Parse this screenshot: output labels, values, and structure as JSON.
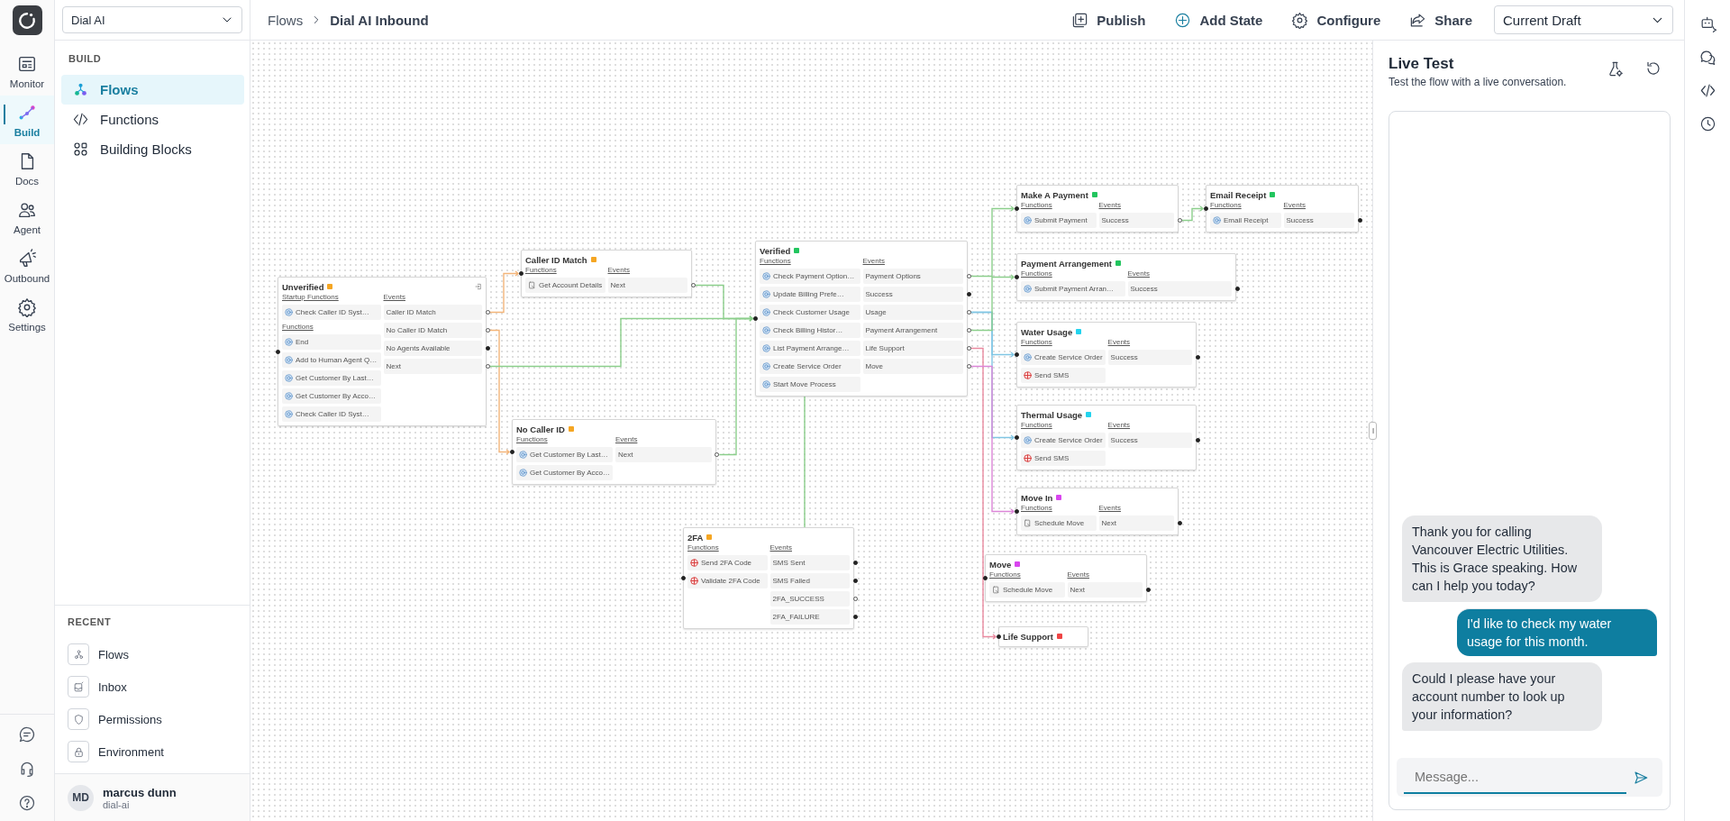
{
  "workspace": {
    "value": "Dial AI"
  },
  "rail": {
    "items": [
      {
        "label": "Monitor",
        "kind": "monitor",
        "selected": false
      },
      {
        "label": "Build",
        "kind": "build",
        "selected": true
      },
      {
        "label": "Docs",
        "kind": "docs",
        "selected": false
      },
      {
        "label": "Agent",
        "kind": "agent",
        "selected": false
      },
      {
        "label": "Outbound",
        "kind": "outbound",
        "selected": false
      },
      {
        "label": "Settings",
        "kind": "settings",
        "selected": false
      }
    ]
  },
  "sidebar": {
    "heading": "BUILD",
    "items": [
      {
        "label": "Flows",
        "kind": "flows",
        "selected": true
      },
      {
        "label": "Functions",
        "kind": "functions",
        "selected": false
      },
      {
        "label": "Building Blocks",
        "kind": "blocks",
        "selected": false
      }
    ]
  },
  "recent": {
    "heading": "RECENT",
    "items": [
      {
        "label": "Flows",
        "kind": "flows"
      },
      {
        "label": "Inbox",
        "kind": "inbox"
      },
      {
        "label": "Permissions",
        "kind": "permissions"
      },
      {
        "label": "Environment",
        "kind": "environment"
      }
    ]
  },
  "user": {
    "initials": "MD",
    "name": "marcus dunn",
    "org": "dial-ai"
  },
  "breadcrumb": [
    "Flows",
    "Dial AI Inbound"
  ],
  "actions": [
    {
      "label": "Publish",
      "kind": "publish"
    },
    {
      "label": "Add State",
      "kind": "add"
    },
    {
      "label": "Configure",
      "kind": "configure"
    },
    {
      "label": "Share",
      "kind": "share"
    }
  ],
  "version": {
    "value": "Current Draft"
  },
  "flow": {
    "nodes": [
      {
        "title": "Unverified",
        "color": "#f5a623",
        "start": true,
        "sections": [
          {
            "heading": "Startup Functions",
            "items": [
              {
                "label": "Check Caller ID Syst…",
                "kind": "system"
              }
            ]
          },
          {
            "heading": "Functions",
            "items": [
              {
                "label": "End",
                "kind": "system"
              },
              {
                "label": "Add to Human Agent Q…",
                "kind": "system"
              },
              {
                "label": "Get Customer By Last…",
                "kind": "system"
              },
              {
                "label": "Get Customer By Acco…",
                "kind": "system"
              },
              {
                "label": "Check Caller ID Syst…",
                "kind": "system"
              }
            ]
          }
        ],
        "events_heading": "Events",
        "events": [
          "Caller ID Match",
          "No Caller ID Match",
          "No Agents Available",
          "Next"
        ]
      },
      {
        "title": "Caller ID Match",
        "color": "#f5a623",
        "start": false,
        "sections": [
          {
            "heading": "Functions",
            "items": [
              {
                "label": "Get Account Details",
                "kind": "doc"
              }
            ]
          }
        ],
        "events_heading": "Events",
        "events": [
          "Next"
        ]
      },
      {
        "title": "No Caller ID",
        "color": "#f5a623",
        "start": false,
        "sections": [
          {
            "heading": "Functions",
            "items": [
              {
                "label": "Get Customer By Last…",
                "kind": "system"
              },
              {
                "label": "Get Customer By Acco…",
                "kind": "system"
              }
            ]
          }
        ],
        "events_heading": "Events",
        "events": [
          "Next"
        ]
      },
      {
        "title": "2FA",
        "color": "#f5a623",
        "start": false,
        "sections": [
          {
            "heading": "Functions",
            "items": [
              {
                "label": "Send 2FA Code",
                "kind": "sms"
              },
              {
                "label": "Validate 2FA Code",
                "kind": "sms"
              }
            ]
          }
        ],
        "events_heading": "Events",
        "events": [
          "SMS Sent",
          "SMS Failed",
          "2FA_SUCCESS",
          "2FA_FAILURE"
        ]
      },
      {
        "title": "Verified",
        "color": "#22c55e",
        "start": false,
        "sections": [
          {
            "heading": "Functions",
            "items": [
              {
                "label": "Check Payment Option…",
                "kind": "system"
              },
              {
                "label": "Update Billing Prefe…",
                "kind": "system"
              },
              {
                "label": "Check Customer Usage",
                "kind": "system"
              },
              {
                "label": "Check Billing Histor…",
                "kind": "system"
              },
              {
                "label": "List Payment Arrange…",
                "kind": "system"
              },
              {
                "label": "Create Service Order",
                "kind": "system"
              },
              {
                "label": "Start Move Process",
                "kind": "system"
              }
            ]
          }
        ],
        "events_heading": "Events",
        "events": [
          "Payment Options",
          "Success",
          "Usage",
          "Payment Arrangement",
          "Life Support",
          "Move"
        ]
      },
      {
        "title": "Make A Payment",
        "color": "#22c55e",
        "start": false,
        "sections": [
          {
            "heading": "Functions",
            "items": [
              {
                "label": "Submit Payment",
                "kind": "system"
              }
            ]
          }
        ],
        "events_heading": "Events",
        "events": [
          "Success"
        ]
      },
      {
        "title": "Email Receipt",
        "color": "#22c55e",
        "start": false,
        "sections": [
          {
            "heading": "Functions",
            "items": [
              {
                "label": "Email Receipt",
                "kind": "system"
              }
            ]
          }
        ],
        "events_heading": "Events",
        "events": [
          "Success"
        ]
      },
      {
        "title": "Payment Arrangement",
        "color": "#22c55e",
        "start": false,
        "sections": [
          {
            "heading": "Functions",
            "items": [
              {
                "label": "Submit Payment Arran…",
                "kind": "system"
              }
            ]
          }
        ],
        "events_heading": "Events",
        "events": [
          "Success"
        ]
      },
      {
        "title": "Water Usage",
        "color": "#22d3ee",
        "start": false,
        "sections": [
          {
            "heading": "Functions",
            "items": [
              {
                "label": "Create Service Order",
                "kind": "system"
              },
              {
                "label": "Send SMS",
                "kind": "sms"
              }
            ]
          }
        ],
        "events_heading": "Events",
        "events": [
          "Success"
        ]
      },
      {
        "title": "Thermal Usage",
        "color": "#22d3ee",
        "start": false,
        "sections": [
          {
            "heading": "Functions",
            "items": [
              {
                "label": "Create Service Order",
                "kind": "system"
              },
              {
                "label": "Send SMS",
                "kind": "sms"
              }
            ]
          }
        ],
        "events_heading": "Events",
        "events": [
          "Success"
        ]
      },
      {
        "title": "Move In",
        "color": "#d946ef",
        "start": false,
        "sections": [
          {
            "heading": "Functions",
            "items": [
              {
                "label": "Schedule Move",
                "kind": "doc"
              }
            ]
          }
        ],
        "events_heading": "Events",
        "events": [
          "Next"
        ]
      },
      {
        "title": "Move",
        "color": "#d946ef",
        "start": false,
        "sections": [
          {
            "heading": "Functions",
            "items": [
              {
                "label": "Schedule Move",
                "kind": "doc"
              }
            ]
          }
        ],
        "events_heading": "Events",
        "events": [
          "Next"
        ]
      },
      {
        "title": "Life Support",
        "color": "#ef4444",
        "start": false
      }
    ]
  },
  "live_test": {
    "title": "Live Test",
    "subtitle": "Test the flow with a live conversation.",
    "messages": [
      {
        "kind": "agent",
        "text": "Thank you for calling Vancouver Electric Utilities. This is Grace speaking. How can I help you today?"
      },
      {
        "kind": "user",
        "text": "I'd like to check my water usage for this month."
      },
      {
        "kind": "agent",
        "text": "Could I please have your account number to look up your information?"
      }
    ],
    "input": {
      "placeholder": "Message..."
    }
  }
}
